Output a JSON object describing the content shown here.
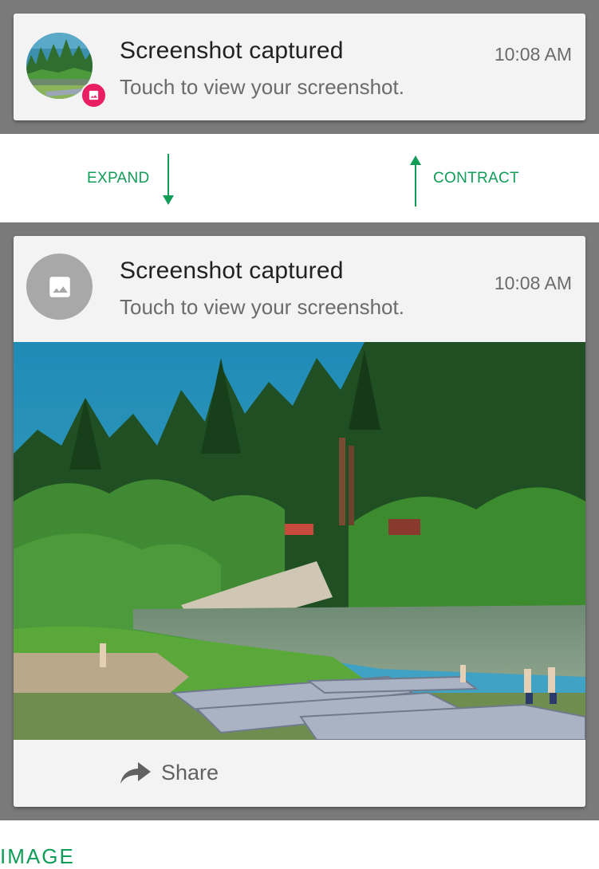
{
  "notification": {
    "title": "Screenshot captured",
    "text": "Touch to view your screenshot.",
    "time": "10:08 AM"
  },
  "actions": {
    "share_label": "Share",
    "share_icon": "share-arrow-icon"
  },
  "transitions": {
    "expand_label": "EXPAND",
    "contract_label": "CONTRACT"
  },
  "caption": "IMAGE",
  "colors": {
    "accent_green": "#0f9d58",
    "badge_pink": "#e91e63",
    "backdrop_grey": "#7a7a7a",
    "card_bg": "#f3f3f3"
  },
  "icons": {
    "badge": "image-icon",
    "large_icon": "image-icon"
  }
}
